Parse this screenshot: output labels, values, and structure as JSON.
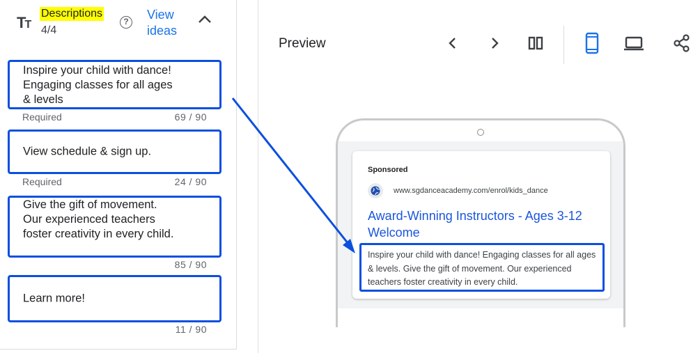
{
  "descriptions": {
    "title": "Descriptions",
    "count": "4/4",
    "view_ideas": "View ideas",
    "items": [
      {
        "text": "Inspire your child with dance! Engaging classes for all ages & levels",
        "requirement": "Required",
        "counter": "69 / 90"
      },
      {
        "text": "View schedule & sign up.",
        "requirement": "Required",
        "counter": "24 / 90"
      },
      {
        "text": "Give the gift of movement. Our experienced teachers foster creativity in every child.",
        "requirement": "",
        "counter": "85 / 90"
      },
      {
        "text": "Learn more!",
        "requirement": "",
        "counter": "11 / 90"
      }
    ]
  },
  "preview": {
    "title": "Preview",
    "toolbar": {
      "icons": [
        "chevron-left-icon",
        "chevron-right-icon",
        "split-view-icon",
        "mobile-icon",
        "laptop-icon",
        "share-icon"
      ],
      "active": "mobile-icon"
    },
    "ad": {
      "sponsored": "Sponsored",
      "url": "www.sgdanceacademy.com/enrol/kids_dance",
      "headline": "Award-Winning Instructors - Ages 3-12 Welcome",
      "description": "Inspire your child with dance! Engaging classes for all ages & levels. Give the gift of movement. Our experienced teachers foster creativity in every child."
    }
  },
  "colors": {
    "highlight": "#ffff00",
    "annotation_blue": "#0b4fe0",
    "link_blue": "#1a73e8",
    "headline_blue": "#1a56db"
  }
}
